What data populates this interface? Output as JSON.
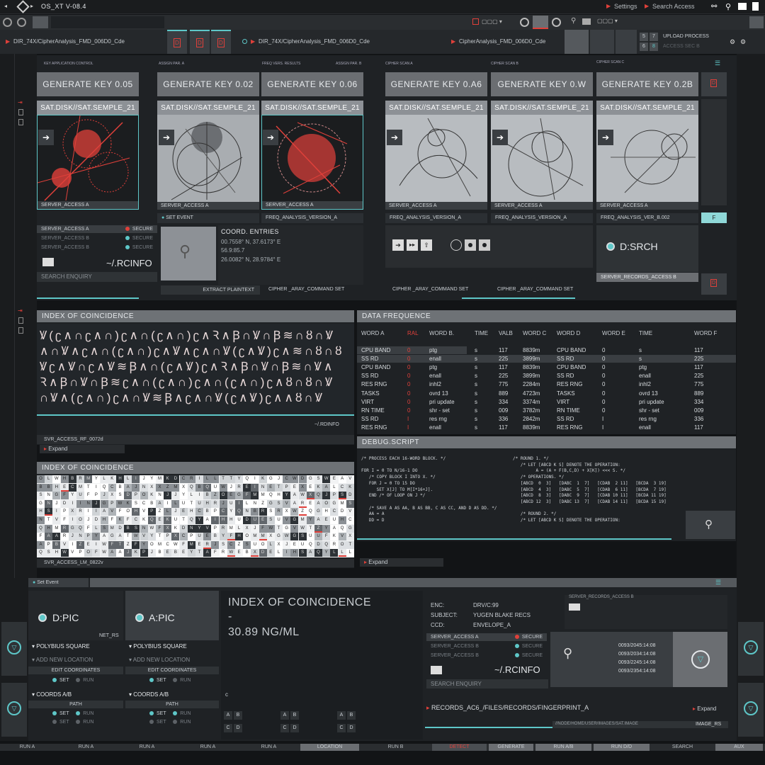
{
  "app": {
    "title": "OS_XT V-08.4",
    "settings": "Settings",
    "search_access": "Search Access"
  },
  "tabs": {
    "left_path": "DIR_74X/CipherAnalysis_FMD_006D0_Cde",
    "mid_path": "DIR_74X/CipherAnalysis_FMD_006D0_Cde",
    "right_path": "CipherAnalysis_FMD_006D0_Cde",
    "upload": "UPLOAD PROCESS",
    "access": "ACCESS SEC B",
    "n5": "5",
    "n7": "7",
    "n6": "6",
    "n8": "8"
  },
  "top": {
    "labels": [
      "KEY APPLICATION CONTROL",
      "ASSIGN PAR. A",
      "FREQ VERS. RESULTS",
      "ASSIGN PAR. B",
      "CIPHER SCAN A",
      "CIPHER SCAN B",
      "CIPHER SCAN C"
    ],
    "keys": [
      "GENERATE KEY 0.05",
      "GENERATE KEY 0.02",
      "GENERATE KEY 0.06",
      "GENERATE KEY 0.A6",
      "GENERATE KEY 0.W",
      "GENERATE KEY 0.2B"
    ],
    "sat": "SAT.DISK//SAT.SEMPLE_21",
    "server_access": "SERVER_ACCESS A",
    "set_event": "SET EVENT",
    "freq": [
      "FREQ_ANALYSIS_VERSION_A",
      "FREQ_ANALYSIS_VERSION_A",
      "FREQ_ANALYSIS_VERSION_A",
      "FREQ_ANALYSIS_VER_B.002"
    ],
    "f_btn": "F",
    "servers": [
      {
        "name": "SERVER_ACCESS A",
        "status": "SECURE"
      },
      {
        "name": "SERVER_ACCESS B",
        "status": "SECURE"
      },
      {
        "name": "SERVER_ACCESS B",
        "status": "SECURE"
      }
    ],
    "rcinfo": "~/.RCINFO",
    "search_enquiry": "SEARCH ENQUIRY",
    "coord_title": "COORD. ENTRIES",
    "coords": [
      "00.7558° N, 37.6173° E",
      "56.9:85.7",
      "26.0082° N, 28.9784° E"
    ],
    "extract": "EXTRACT PLAINTEXT",
    "cipher_cmd": "CIPHER _ARAY_COMMAND SET",
    "dsrch": "D:SRCH",
    "server_records": "SERVER_RECORDS_ACCESS B",
    "doc_icon": "D"
  },
  "ioc1": {
    "title": "INDEX OF COINCIDENCE",
    "path": "~/.RDINFO",
    "svr": "SVR_ACCESS_RF_0072d",
    "expand": "Expand",
    "glyphs": [
      "Ꝟ(ʗ∧∩ʗ∧∩)ʗ∧∩(ʗ∧∩)ʗ∧Ꝛ∧Ꞵ∩Ꝟ∩Ꞵ≋∩ȣ∩Ꝟ",
      "∧∩Ꝟ∧ʗ∧∩(ʗ∧∩)ʗ∧Ꝟ∧ʗ∧∩Ꝟ(ʗ∧Ꝟ)ʗ∧≋∩ȣ∩ȣ",
      "Ꝟʗ∧Ꝟ∩ʗ∧Ꝟ≋Ꞵ∧∩(ʗ∧Ꝟ)ʗ∧Ꝛ∧Ꞵ∩Ꝟ∩Ꞵ≋∩Ꝟ∧",
      "Ꝛ∧Ꞵ∩Ꝟ∩Ꞵ≋ʗ∧∩(ʗ∧∩)ʗ∧∩(ʗ∧∩)ʗ∧ȣ∩ȣ∩Ꝟ",
      "∩Ꝟ∧(ʗ∧∩)ʗ∧∩Ꝟ≋Ꞵ∧ʗ∧∩Ꝟ(ʗ∧Ꝟ)ʗ∧∧ȣ∩Ꝟ",
      "Ꝟʗ∧Ꝛ∧Ꞵ∩Ꝟ∩Ꞵ≋(ʗ∧∩)ʗ∧∩(ʗ∧Ꝟ)ʗ∧≋∩Ꝟ∩ȣ"
    ]
  },
  "ioc2": {
    "title": "INDEX OF COINCIDENCE",
    "svr": "SVR_ACCESS_LM_0822v"
  },
  "freqtable": {
    "title": "DATA FREQUENCE",
    "headers": [
      "WORD A",
      "RAL",
      "WORD B.",
      "TIME",
      "VALB",
      "WORD C",
      "WORD D",
      "WORD E",
      "TIME",
      "WORD F"
    ],
    "rows": [
      [
        "CPU BAND",
        "0",
        "ptg",
        "s",
        "117",
        "8839m",
        "CPU BAND",
        "0",
        "s",
        "117"
      ],
      [
        "SS RD",
        "0",
        "enall",
        "s",
        "225",
        "3899m",
        "SS RD",
        "0",
        "s",
        "225"
      ],
      [
        "CPU BAND",
        "0",
        "ptg",
        "s",
        "117",
        "8839m",
        "CPU BAND",
        "0",
        "ptg",
        "117"
      ],
      [
        "SS RD",
        "0",
        "enall",
        "s",
        "225",
        "3899m",
        "SS RD",
        "0",
        "enall",
        "225"
      ],
      [
        "RES RNG",
        "0",
        "inhl2",
        "s",
        "775",
        "2284m",
        "RES RNG",
        "0",
        "inhl2",
        "775"
      ],
      [
        "TASKS",
        "0",
        "ovrd   13",
        "s",
        "889",
        "4723m",
        "TASKS",
        "0",
        "ovrd   13",
        "889"
      ],
      [
        "VIRT",
        "0",
        "pri update",
        "s",
        "334",
        "3374m",
        "VIRT",
        "0",
        "pri update",
        "334"
      ],
      [
        "RN TIME",
        "0",
        "shr - set",
        "s",
        "009",
        "3782m",
        "RN TIME",
        "0",
        "shr - set",
        "009"
      ],
      [
        "SS RD",
        "I",
        "res rng",
        "s",
        "336",
        "2842m",
        "SS RD",
        "I",
        "res rng",
        "336"
      ],
      [
        "RES RNG",
        "I",
        "enall",
        "s",
        "117",
        "8839m",
        "RES RNG",
        "I",
        "enall",
        "117"
      ]
    ]
  },
  "debug": {
    "title": "DEBUG.SCRIPT",
    "expand": "Expand",
    "left": [
      "/* PROCESS EACH 16-WORD BLOCK. */",
      "",
      "FOR I = 0 TO N/16-1 DO",
      "   /* COPY BLOCK I INTO X. */",
      "   FOR J = 0 TO 15 DO",
      "      SET X[J] TO M[I*16+J].",
      "   END /* OF LOOP ON J */",
      "",
      "   /* SAVE A AS AA, B AS BB, C AS CC, AND D AS DD. */",
      "   AA = A",
      "   DD = D"
    ],
    "right": [
      "/* ROUND 1. */",
      "   /* LET [ABCD K S] DENOTE THE OPERATION:",
      "         A = (A + F(B,C,D) + X[K]) <<< S. */",
      "   /* OPERATIONS. */",
      "   [ABCD  0  3]   [DABC  1  7]   [CDAB  2 11]   [BCDA  3 19]",
      "   [ABCD  4  3]   [DABC  5  7]   [CDAB  6 11]   [BCDA  7 19]",
      "   [ABCD  8  3]   [DABC  9  7]   [CDAB 10 11]   [BCDA 11 19]",
      "   [ABCD 12  3]   [DABC 13  7]   [CDAB 14 11]   [BCDA 15 19]",
      "",
      "   /* ROUND 2. */",
      "   /* LET [ABCD K S] DENOTE THE OPERATION:"
    ]
  },
  "bottom": {
    "set_event": "Set Event",
    "dpic": "D:PIC",
    "apic": "A:PIC",
    "net": "NET_RS",
    "polybius": "POLYBIUS SQUARE",
    "add_loc": "ADD NEW LOCATION",
    "edit": "EDIT COORDINATES",
    "set": "SET",
    "run": "RUN",
    "coords_ab": "COORDS A/B",
    "path": "PATH",
    "ioc_title": "INDEX OF COINCIDENCE",
    "dash": "-",
    "ioc_val": "30.89 NG/ML",
    "c_label": "c",
    "grid": [
      "A",
      "B",
      "A",
      "B",
      "A",
      "B",
      "C",
      "D",
      "C",
      "D",
      "C",
      "D"
    ],
    "enc_k": "ENC:",
    "enc_v": "DRV/C:99",
    "subj_k": "SUBJECT:",
    "subj_v": "YUGEN BLAKE RECS",
    "ccd_k": "CCD:",
    "ccd_v": "ENVELOPE_A",
    "servers": [
      {
        "name": "SERVER_ACCESS A",
        "status": "SECURE"
      },
      {
        "name": "SERVER_ACCESS B",
        "status": "SECURE"
      },
      {
        "name": "SERVER_ACCESS B",
        "status": "SECURE"
      }
    ],
    "rcinfo": "~/.RCINFO",
    "search_enquiry": "SEARCH ENQUIRY",
    "server_records": "SERVER_RECORDS_ACCESS B",
    "times": [
      "0093/2045:14:08",
      "0093/2034:14:08",
      "0093/2245:14:08",
      "0093/2354:14:08"
    ],
    "records": "RECORDS_AC6_/FILES/RECORDS/FINGERPRINT_A",
    "expand": "Expand",
    "node": "//NODE/HOME/USER/IMAGES/SAT.IMAGE",
    "image_rs": "IMAGE_RS"
  },
  "footer": [
    "RUN A",
    "RUN A",
    "RUN A",
    "RUN A",
    "RUN A",
    "LOCATION",
    "RUN B",
    "DETECT",
    "GENERATE",
    "RUN A/B",
    "RUN D/D",
    "SEARCH",
    "AUX"
  ],
  "colors": {
    "accent": "#5ec7c8",
    "alert": "#e0403a",
    "panel": "#6b6e72"
  }
}
